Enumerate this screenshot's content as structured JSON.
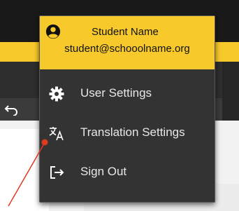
{
  "user": {
    "name": "Student Name",
    "email": "student@schooolname.org",
    "icon": "account-circle-icon"
  },
  "menu": {
    "items": [
      {
        "label": "User Settings",
        "icon": "gear-icon"
      },
      {
        "label": "Translation Settings",
        "icon": "translate-icon"
      },
      {
        "label": "Sign Out",
        "icon": "sign-out-icon"
      }
    ]
  },
  "colors": {
    "header_yellow": "#f7c92a",
    "menu_background": "#333333",
    "menu_text": "#e8e8e8",
    "annotation_arrow": "#e03a1e"
  }
}
